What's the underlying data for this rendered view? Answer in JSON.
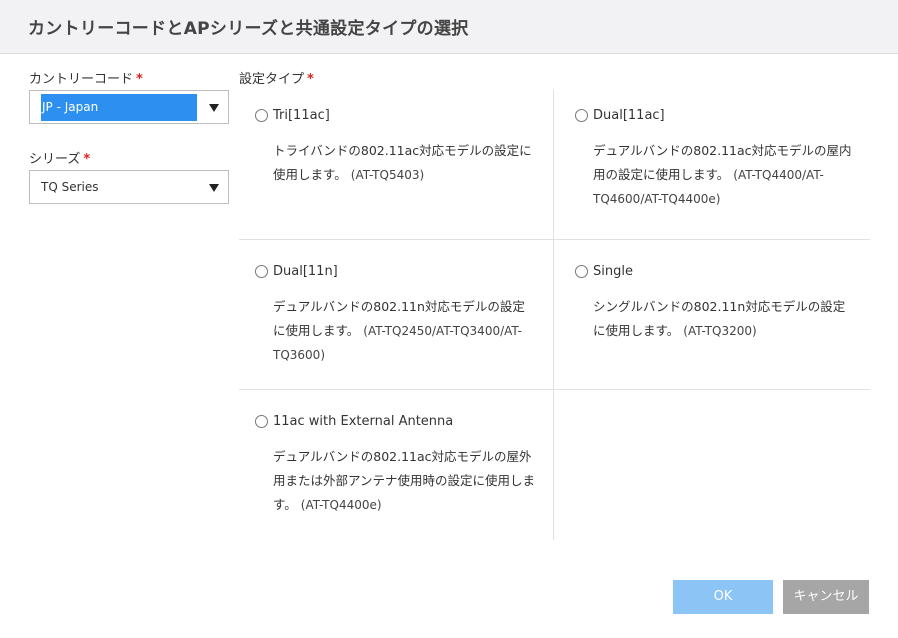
{
  "dialog": {
    "title": "カントリーコードとAPシリーズと共通設定タイプの選択"
  },
  "country": {
    "label": "カントリーコード",
    "required_mark": "*",
    "value": "JP - Japan"
  },
  "series": {
    "label": "シリーズ",
    "required_mark": "*",
    "value": "TQ Series"
  },
  "settings_type": {
    "label": "設定タイプ",
    "required_mark": "*",
    "options": [
      {
        "title": "Tri[11ac]",
        "desc": "トライバンドの802.11ac対応モデルの設定に使用します。",
        "models": "(AT-TQ5403)"
      },
      {
        "title": "Dual[11ac]",
        "desc": "デュアルバンドの802.11ac対応モデルの屋内用の設定に使用します。",
        "models": "(AT-TQ4400/AT-TQ4600/AT-TQ4400e)"
      },
      {
        "title": "Dual[11n]",
        "desc": "デュアルバンドの802.11n対応モデルの設定に使用します。",
        "models": "(AT-TQ2450/AT-TQ3400/AT-TQ3600)"
      },
      {
        "title": "Single",
        "desc": "シングルバンドの802.11n対応モデルの設定に使用します。",
        "models": "(AT-TQ3200)"
      },
      {
        "title": "11ac with External Antenna",
        "desc": "デュアルバンドの802.11ac対応モデルの屋外用または外部アンテナ使用時の設定に使用します。",
        "models": "(AT-TQ4400e)"
      }
    ]
  },
  "buttons": {
    "ok": "OK",
    "cancel": "キャンセル"
  },
  "colors": {
    "ok_button": "#8cc4f5",
    "cancel_button": "#a6a6a6",
    "selection": "#2d8ff0",
    "required": "#d9261c"
  }
}
